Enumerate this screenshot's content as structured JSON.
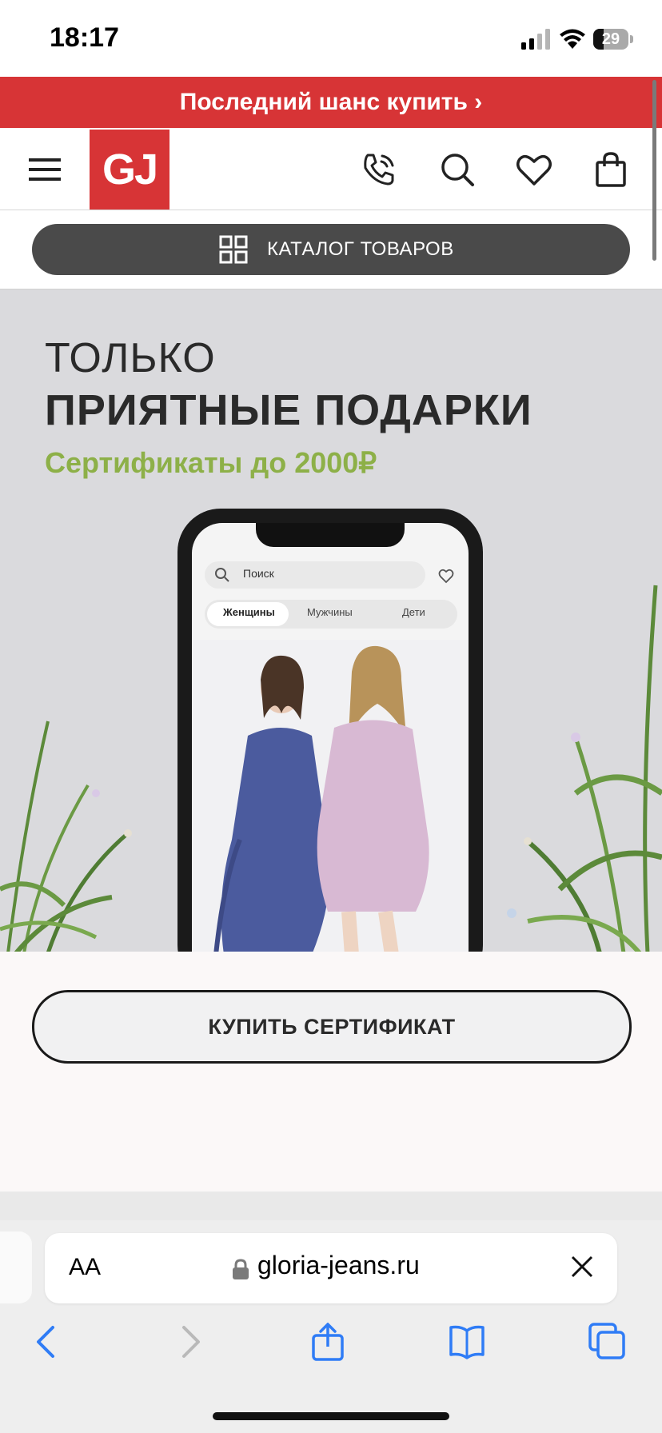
{
  "status_bar": {
    "time": "18:17",
    "battery": "29",
    "signal_icon": "cellular-signal-icon",
    "wifi_icon": "wifi-icon"
  },
  "promo": {
    "text": "Последний шанс купить ›"
  },
  "header": {
    "logo": "GJ",
    "icons": [
      "menu-icon",
      "phone-call-icon",
      "search-icon",
      "heart-icon",
      "shopping-bag-icon"
    ],
    "catalog_label": "КАТАЛОГ ТОВАРОВ",
    "catalog_icon": "grid-icon"
  },
  "banner": {
    "line1": "ТОЛЬКО",
    "line2": "ПРИЯТНЫЕ ПОДАРКИ",
    "line3": "Сертификаты до 2000₽",
    "accent_color": "#8db048",
    "phone_mock": {
      "search_placeholder": "Поиск",
      "tabs": [
        "Женщины",
        "Мужчины",
        "Дети"
      ],
      "active_tab": "Женщины"
    }
  },
  "cta": {
    "label": "КУПИТЬ СЕРТИФИКАТ"
  },
  "browser": {
    "aa_label": "AA",
    "url": "gloria-jeans.ru",
    "nav_icons": [
      "back-icon",
      "forward-icon",
      "share-icon",
      "bookmarks-icon",
      "tabs-icon"
    ]
  },
  "colors": {
    "brand_red": "#d73436",
    "dark_button": "#4a4a4a"
  }
}
